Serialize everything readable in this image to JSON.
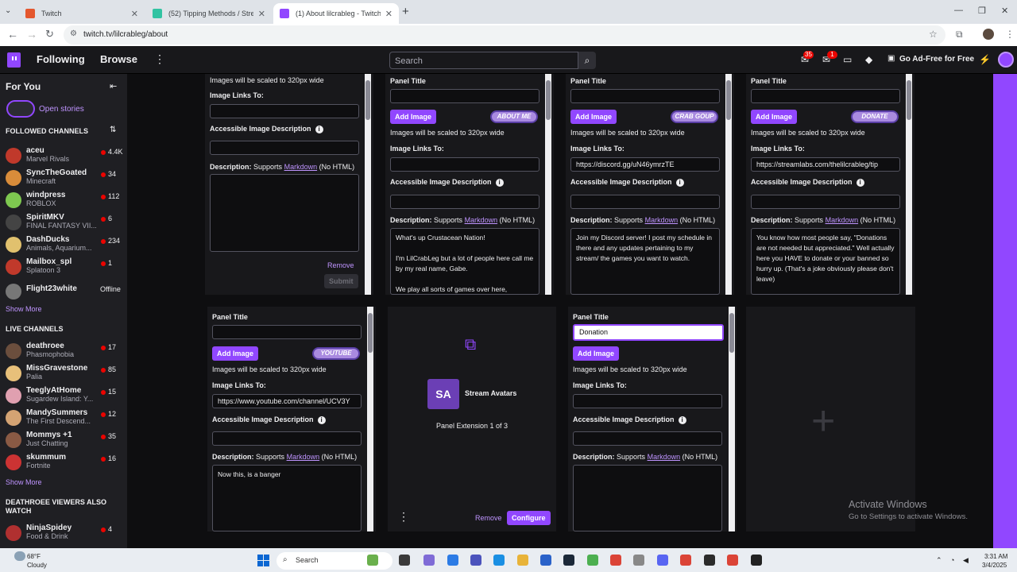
{
  "browser": {
    "tabs": [
      {
        "title": "Twitch",
        "favicon_color": "#e4572e"
      },
      {
        "title": "(52) Tipping Methods / Streaml",
        "favicon_color": "#31c3a2"
      },
      {
        "title": "(1) About lilcrableg - Twitch",
        "favicon_color": "#9147ff"
      }
    ],
    "url": "twitch.tv/lilcrableg/about"
  },
  "twitch_nav": {
    "following": "Following",
    "browse": "Browse",
    "search_placeholder": "Search",
    "notifications_count": "35",
    "whispers_count": "1",
    "ad_free": "Go Ad-Free for Free"
  },
  "sidebar": {
    "for_you": "For You",
    "open_stories": "Open stories",
    "followed_header": "FOLLOWED CHANNELS",
    "followed": [
      {
        "name": "aceu",
        "game": "Marvel Rivals",
        "viewers": "4.4K",
        "color": "#c0392b"
      },
      {
        "name": "SyncTheGoated",
        "game": "Minecraft",
        "viewers": "34",
        "color": "#d98c3a"
      },
      {
        "name": "windpress",
        "game": "ROBLOX",
        "viewers": "112",
        "color": "#7ec850"
      },
      {
        "name": "SpiritMKV",
        "game": "FINAL FANTASY VII...",
        "viewers": "6",
        "color": "#444444"
      },
      {
        "name": "DashDucks",
        "game": "Animals, Aquarium...",
        "viewers": "234",
        "color": "#e1c16e"
      },
      {
        "name": "Mailbox_spl",
        "game": "Splatoon 3",
        "viewers": "1",
        "color": "#c0392b"
      },
      {
        "name": "Flight23white",
        "game": "",
        "viewers": "Offline",
        "color": "#777777"
      }
    ],
    "show_more": "Show More",
    "live_header": "LIVE CHANNELS",
    "live": [
      {
        "name": "deathroee",
        "game": "Phasmophobia",
        "viewers": "17",
        "color": "#6b4e3d"
      },
      {
        "name": "MissGravestone",
        "game": "Palia",
        "viewers": "85",
        "color": "#e8c07a"
      },
      {
        "name": "TeeglyAtHome",
        "game": "Sugardew Island: Y...",
        "viewers": "15",
        "color": "#e0a0b0"
      },
      {
        "name": "MandySummers",
        "game": "The First Descend...",
        "viewers": "12",
        "color": "#d4a373"
      },
      {
        "name": "Mommys +1",
        "game": "Just Chatting",
        "viewers": "35",
        "color": "#8a5a44"
      },
      {
        "name": "skummum",
        "game": "Fortnite",
        "viewers": "16",
        "color": "#cc3333"
      }
    ],
    "viewers_also_header": "DEATHROEE VIEWERS ALSO WATCH",
    "also_watch": [
      {
        "name": "NinjaSpidey",
        "game": "Food & Drink",
        "viewers": "4",
        "color": "#b03030"
      }
    ]
  },
  "panels": {
    "common": {
      "panel_title": "Panel Title",
      "add_image": "Add Image",
      "scaled_note": "Images will be scaled to 320px wide",
      "image_links_to": "Image Links To:",
      "accessible_desc": "Accessible Image Description",
      "description": "Description:",
      "supports": "Supports",
      "markdown": "Markdown",
      "no_html": "(No HTML)",
      "remove": "Remove",
      "submit": "Submit",
      "configure": "Configure"
    },
    "p2": {
      "preview": "ABOUT ME",
      "link": "",
      "desc": "What's up Crustacean Nation!\n\nI'm LilCrabLeg but a lot of people here call me by my real name, Gabe.\n\nWe play all sorts of games over here,"
    },
    "p3": {
      "preview": "CRAB GOUP",
      "link": "https://discord.gg/uN46ymrzTE",
      "desc": "Join my Discord server! I post my schedule in there and any updates pertaining to my stream/ the games you want to watch."
    },
    "p4": {
      "preview": "DONATE",
      "link": "https://streamlabs.com/thelilcrableg/tip",
      "desc": "You know how most people say, \"Donations are not needed but appreciated.\" Well actually here you HAVE to donate or your banned so hurry up. (That's a joke obviously please don't leave)"
    },
    "p5": {
      "preview": "YOUTUBE",
      "link": "https://www.youtube.com/channel/UCV3Y",
      "desc": "Now this, is a banger"
    },
    "ext": {
      "name": "Stream Avatars",
      "logo": "SA",
      "count": "Panel Extension 1 of 3"
    },
    "p7": {
      "title_value": "Donation"
    }
  },
  "watermark": {
    "line1": "Activate Windows",
    "line2": "Go to Settings to activate Windows."
  },
  "taskbar": {
    "temp": "68°F",
    "weather": "Cloudy",
    "search": "Search",
    "time": "3:31 AM",
    "date": "3/4/2025"
  }
}
